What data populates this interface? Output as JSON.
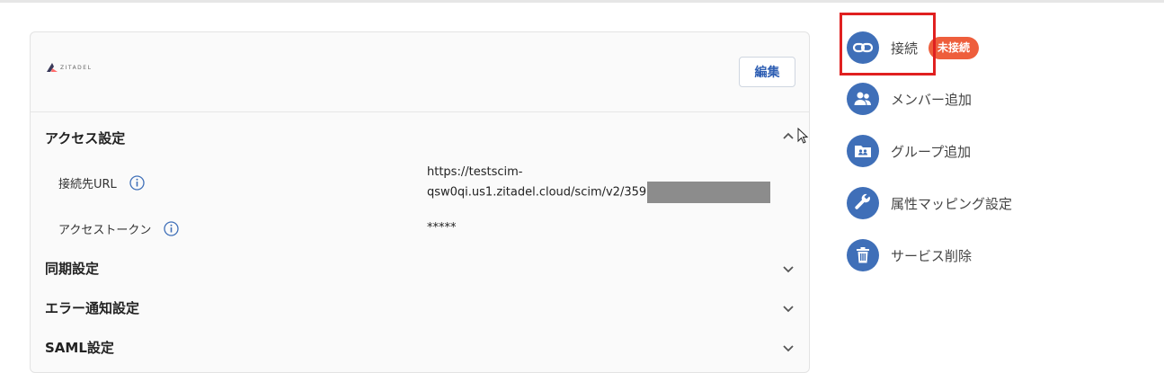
{
  "card": {
    "logo_text": "ZITADEL",
    "edit_label": "編集",
    "sections": {
      "access": "アクセス設定",
      "sync": "同期設定",
      "error_notify": "エラー通知設定",
      "saml": "SAML設定"
    },
    "rows": {
      "url_label": "接続先URL",
      "url_value_line1": "https://testscim-",
      "url_value_line2": "qsw0qi.us1.zitadel.cloud/scim/v2/359",
      "token_label": "アクセストークン",
      "token_value": "*****"
    }
  },
  "actions": {
    "connect_label": "接続",
    "connect_status": "未接続",
    "add_member_label": "メンバー追加",
    "add_group_label": "グループ追加",
    "attribute_mapping_label": "属性マッピング設定",
    "delete_service_label": "サービス削除"
  },
  "colors": {
    "accent": "#3f6fb8",
    "badge": "#ee5e3c",
    "highlight": "#e02020"
  }
}
